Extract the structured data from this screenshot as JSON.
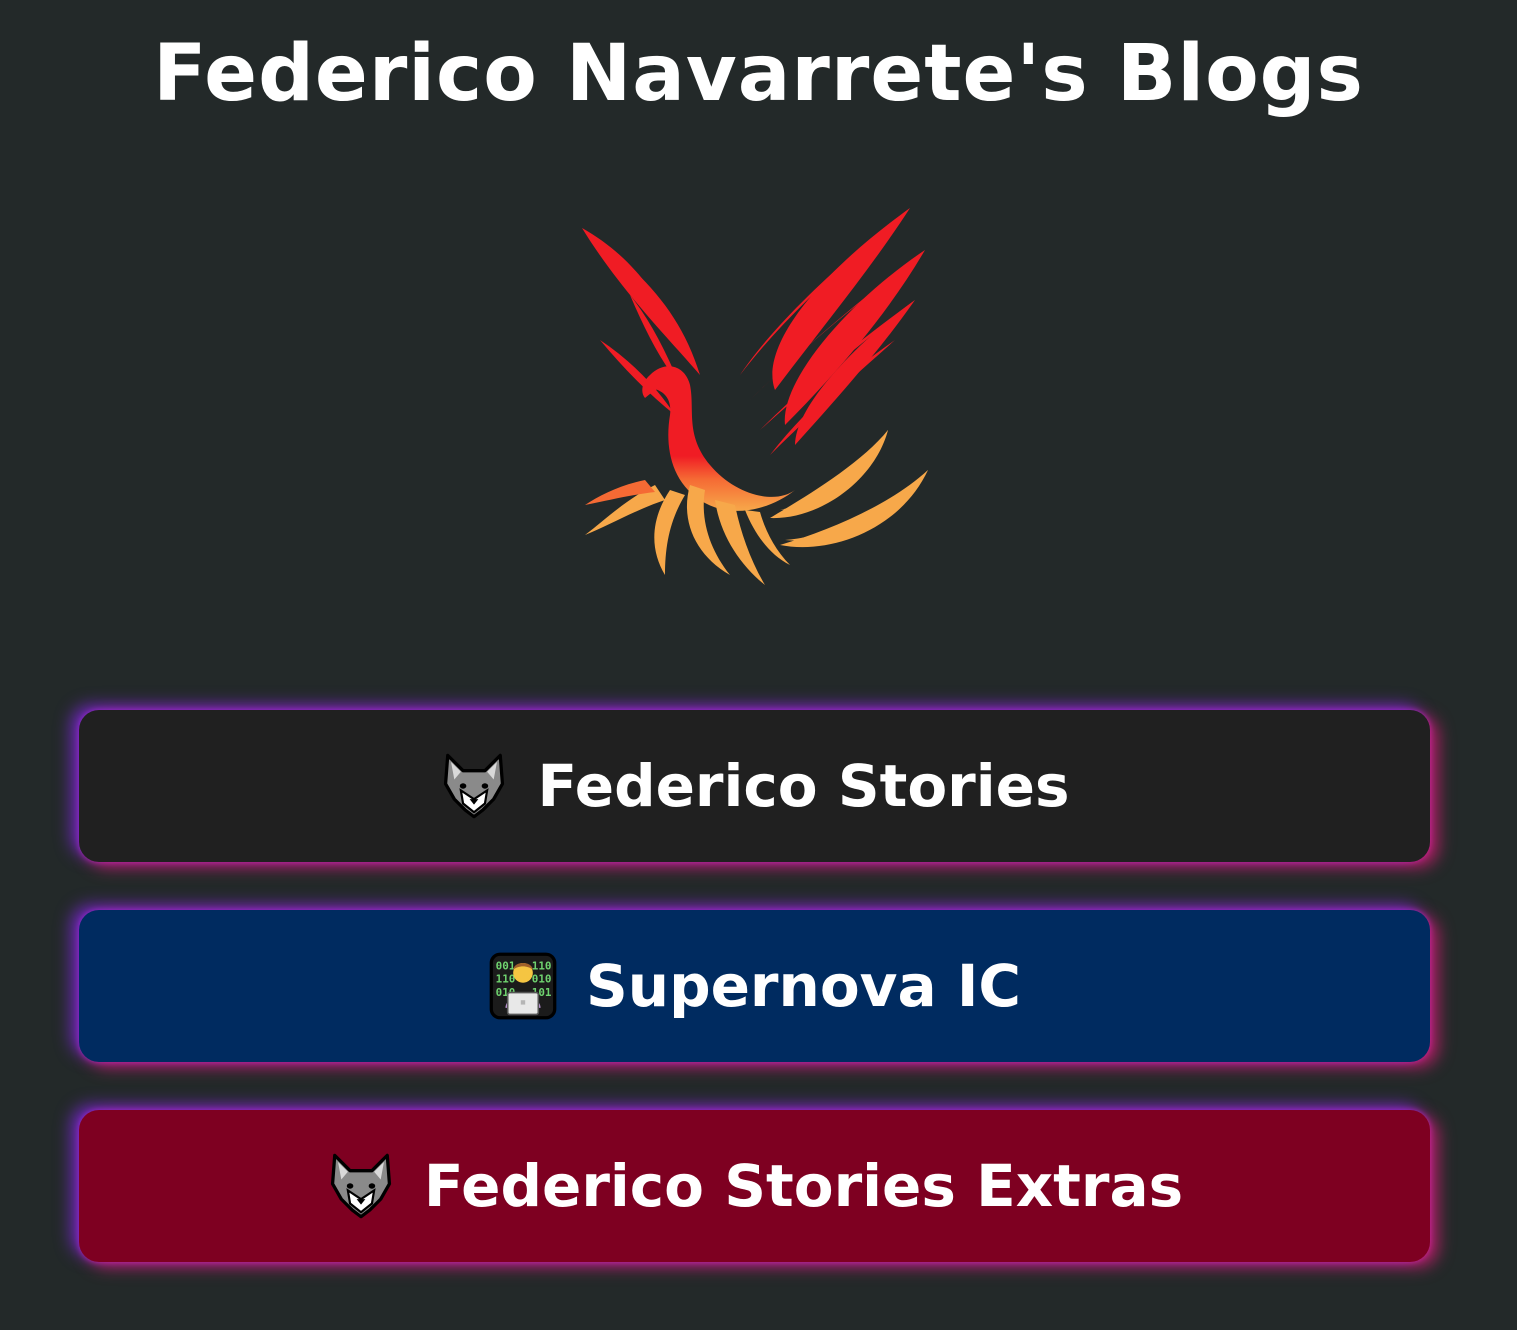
{
  "header": {
    "title": "Federico Navarrete's Blogs"
  },
  "logo": {
    "icon": "phoenix-logo",
    "colors": {
      "red": "#f01c24",
      "orange": "#f7a84a"
    }
  },
  "links": [
    {
      "label": "Federico Stories",
      "icon": "wolf-icon",
      "background": "#202020"
    },
    {
      "label": "Supernova IC",
      "icon": "technologist-icon",
      "background": "#002b60"
    },
    {
      "label": "Federico Stories Extras",
      "icon": "wolf-icon",
      "background": "#7e0021"
    }
  ],
  "glow": {
    "left": "#8228e6",
    "right": "#e61e78"
  }
}
